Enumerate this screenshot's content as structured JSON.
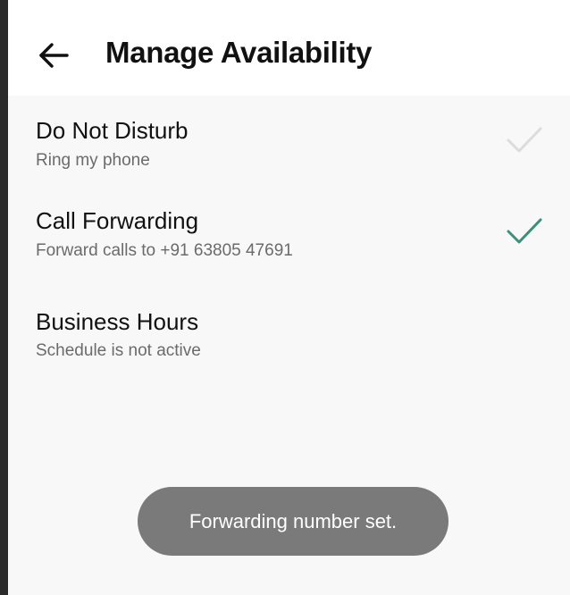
{
  "header": {
    "title": "Manage Availability",
    "back_icon": "arrow-left-icon"
  },
  "items": [
    {
      "title": "Do Not Disturb",
      "subtitle": "Ring my phone",
      "checked": false,
      "check_color": "#dcdcdc"
    },
    {
      "title": "Call Forwarding",
      "subtitle": "Forward calls to +91 63805 47691",
      "checked": true,
      "check_color": "#3d8f7a"
    },
    {
      "title": "Business Hours",
      "subtitle": "Schedule is not active"
    }
  ],
  "toast": {
    "message": "Forwarding number set."
  },
  "colors": {
    "accent": "#3d8f7a",
    "toast_bg": "#7a7a7a"
  }
}
